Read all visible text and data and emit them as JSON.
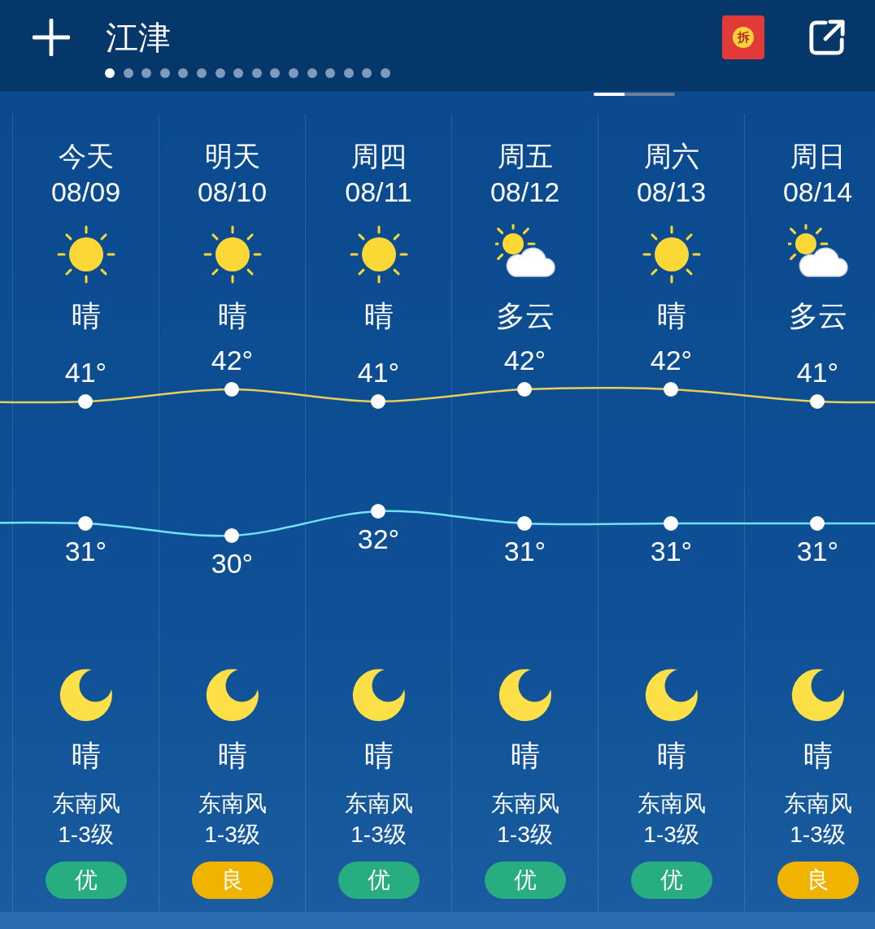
{
  "header": {
    "city": "江津",
    "red_packet_label": "拆"
  },
  "page_dots": [
    {
      "selected": true
    },
    {
      "selected": false
    },
    {
      "selected": false
    },
    {
      "selected": false
    },
    {
      "selected": false
    },
    {
      "selected": false
    },
    {
      "selected": false
    },
    {
      "selected": false
    },
    {
      "selected": false
    },
    {
      "selected": false
    },
    {
      "selected": false
    },
    {
      "selected": false
    },
    {
      "selected": false
    },
    {
      "selected": false
    },
    {
      "selected": false
    },
    {
      "selected": false
    }
  ],
  "days": [
    {
      "day": "今天",
      "date": "08/09",
      "kind": "clear",
      "day_condition": "晴",
      "high": "41°",
      "low": "31°",
      "night_condition": "晴",
      "wind": "东南风",
      "wind_level": "1-3级",
      "aqi": {
        "text": "优",
        "color": "#27ad80"
      }
    },
    {
      "day": "明天",
      "date": "08/10",
      "kind": "clear",
      "day_condition": "晴",
      "high": "42°",
      "low": "30°",
      "night_condition": "晴",
      "wind": "东南风",
      "wind_level": "1-3级",
      "aqi": {
        "text": "良",
        "color": "#efb300"
      }
    },
    {
      "day": "周四",
      "date": "08/11",
      "kind": "clear",
      "day_condition": "晴",
      "high": "41°",
      "low": "32°",
      "night_condition": "晴",
      "wind": "东南风",
      "wind_level": "1-3级",
      "aqi": {
        "text": "优",
        "color": "#27ad80"
      }
    },
    {
      "day": "周五",
      "date": "08/12",
      "kind": "partly_cloudy",
      "day_condition": "多云",
      "high": "42°",
      "low": "31°",
      "night_condition": "晴",
      "wind": "东南风",
      "wind_level": "1-3级",
      "aqi": {
        "text": "优",
        "color": "#27ad80"
      }
    },
    {
      "day": "周六",
      "date": "08/13",
      "kind": "clear",
      "day_condition": "晴",
      "high": "42°",
      "low": "31°",
      "night_condition": "晴",
      "wind": "东南风",
      "wind_level": "1-3级",
      "aqi": {
        "text": "优",
        "color": "#27ad80"
      }
    },
    {
      "day": "周日",
      "date": "08/14",
      "kind": "partly_cloudy",
      "day_condition": "多云",
      "high": "41°",
      "low": "31°",
      "night_condition": "晴",
      "wind": "东南风",
      "wind_level": "1-3级",
      "aqi": {
        "text": "良",
        "color": "#efb300"
      }
    }
  ]
}
